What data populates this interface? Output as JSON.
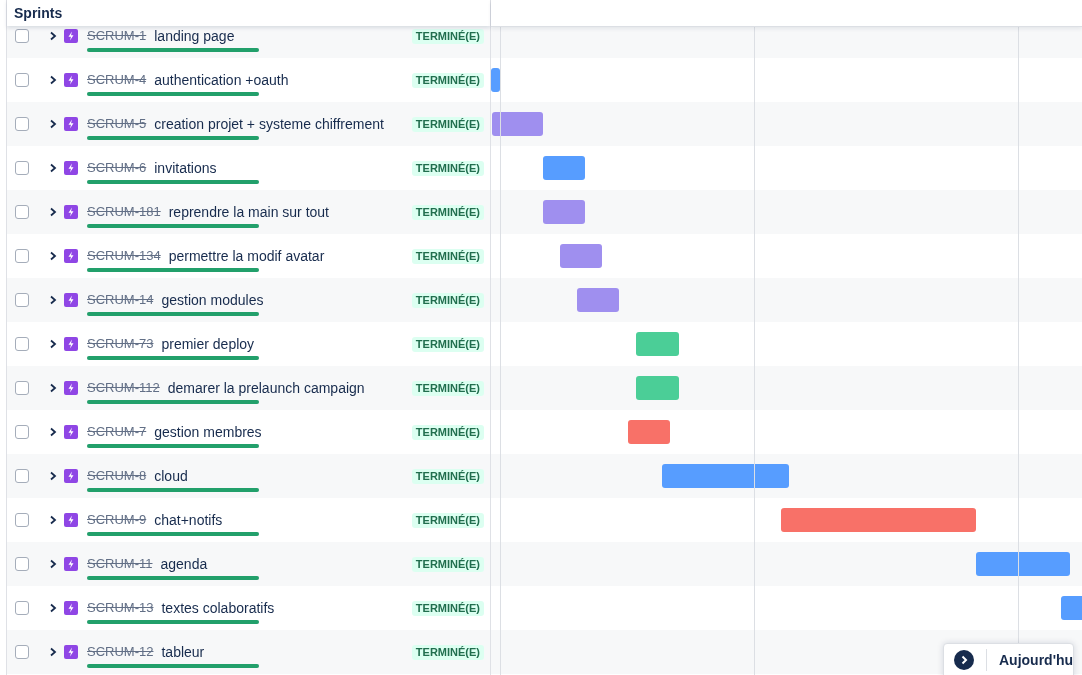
{
  "header": {
    "title": "Sprints"
  },
  "issues": [
    {
      "key": "SCRUM-1",
      "summary": "landing page",
      "status": "TERMINÉ(E)",
      "checked": false,
      "expanded": false,
      "done": true,
      "level": 1
    },
    {
      "key": "SCRUM-4",
      "summary": "authentication +oauth",
      "status": "TERMINÉ(E)",
      "checked": false,
      "expanded": false,
      "done": true,
      "level": 1,
      "color": "#579dff"
    },
    {
      "key": "SCRUM-5",
      "summary": "creation projet + systeme chiffrement",
      "status": "TERMINÉ(E)",
      "checked": false,
      "expanded": false,
      "done": true,
      "level": 1,
      "color": "#9f8fef"
    },
    {
      "key": "SCRUM-6",
      "summary": "invitations",
      "status": "TERMINÉ(E)",
      "checked": false,
      "expanded": false,
      "done": true,
      "level": 1,
      "color": "#579dff"
    },
    {
      "key": "SCRUM-181",
      "summary": "reprendre la main sur tout",
      "status": "TERMINÉ(E)",
      "checked": false,
      "expanded": false,
      "done": true,
      "level": 1,
      "color": "#9f8fef"
    },
    {
      "key": "SCRUM-134",
      "summary": "permettre la modif avatar",
      "status": "TERMINÉ(E)",
      "checked": false,
      "expanded": false,
      "done": true,
      "level": 1,
      "color": "#9f8fef"
    },
    {
      "key": "SCRUM-14",
      "summary": "gestion modules",
      "status": "TERMINÉ(E)",
      "checked": false,
      "expanded": false,
      "done": true,
      "level": 1,
      "color": "#9f8fef"
    },
    {
      "key": "SCRUM-73",
      "summary": "premier deploy",
      "status": "TERMINÉ(E)",
      "checked": false,
      "expanded": false,
      "done": true,
      "level": 1,
      "color": "#4bce97"
    },
    {
      "key": "SCRUM-112",
      "summary": "demarer la prelaunch campaign",
      "status": "TERMINÉ(E)",
      "checked": false,
      "expanded": false,
      "done": true,
      "level": 1,
      "color": "#4bce97"
    },
    {
      "key": "SCRUM-7",
      "summary": "gestion membres",
      "status": "TERMINÉ(E)",
      "checked": false,
      "expanded": false,
      "done": true,
      "level": 1,
      "color": "#f87168"
    },
    {
      "key": "SCRUM-8",
      "summary": "cloud",
      "status": "TERMINÉ(E)",
      "checked": false,
      "expanded": false,
      "done": true,
      "level": 1,
      "color": "#579dff"
    },
    {
      "key": "SCRUM-9",
      "summary": "chat+notifs",
      "status": "TERMINÉ(E)",
      "checked": false,
      "expanded": false,
      "done": true,
      "level": 1,
      "color": "#f87168"
    },
    {
      "key": "SCRUM-11",
      "summary": "agenda",
      "status": "TERMINÉ(E)",
      "checked": false,
      "expanded": false,
      "done": true,
      "level": 1,
      "color": "#579dff"
    },
    {
      "key": "SCRUM-13",
      "summary": "textes colaboratifs",
      "status": "TERMINÉ(E)",
      "checked": false,
      "expanded": false,
      "done": true,
      "level": 1,
      "color": "#579dff"
    },
    {
      "key": "SCRUM-12",
      "summary": "tableur",
      "status": "TERMINÉ(E)",
      "checked": false,
      "expanded": false,
      "done": true,
      "level": 1
    }
  ],
  "today_button": {
    "label": "Aujourd'hu"
  }
}
